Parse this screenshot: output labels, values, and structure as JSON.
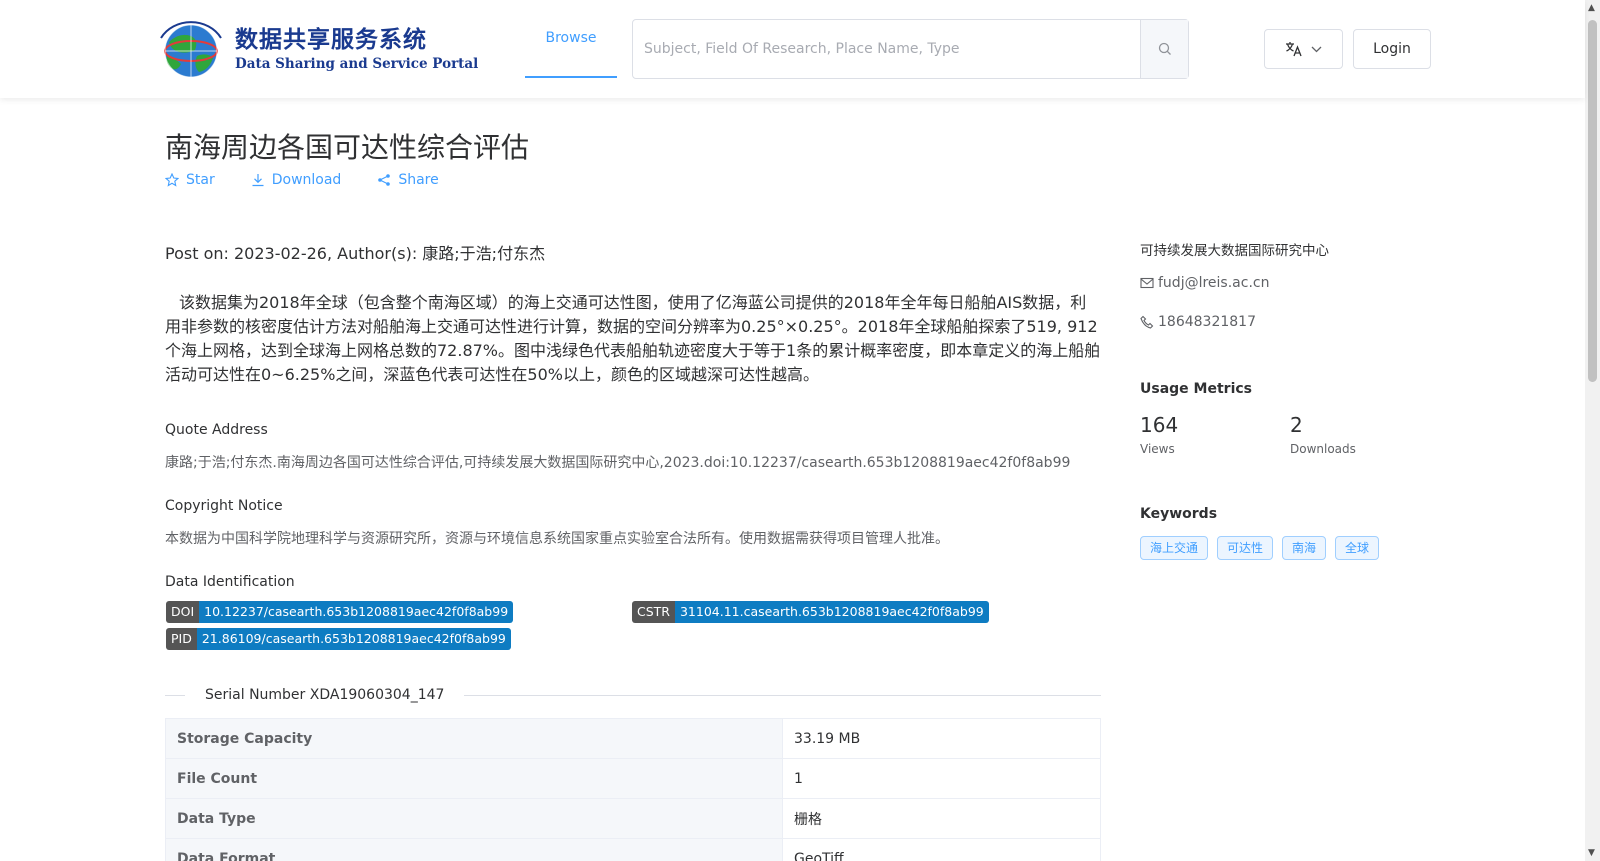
{
  "header": {
    "logo_cn": "数据共享服务系统",
    "logo_en": "Data Sharing and Service Portal",
    "nav_browse": "Browse",
    "search_placeholder": "Subject, Field Of Research, Place Name, Type",
    "login_label": "Login"
  },
  "dataset": {
    "title": "南海周边各国可达性综合评估",
    "actions": {
      "star": "Star",
      "download": "Download",
      "share": "Share"
    },
    "post_on": "Post on: 2023-02-26, Author(s): 康路;于浩;付东杰",
    "description": "该数据集为2018年全球（包含整个南海区域）的海上交通可达性图，使用了亿海蓝公司提供的2018年全年每日船舶AIS数据，利用非参数的核密度估计方法对船舶海上交通可达性进行计算，数据的空间分辨率为0.25°×0.25°。2018年全球船舶探索了519, 912个海上网格，达到全球海上网格总数的72.87%。图中浅绿色代表船舶轨迹密度大于等于1条的累计概率密度，即本章定义的海上船舶活动可达性在0~6.25%之间，深蓝色代表可达性在50%以上，颜色的区域越深可达性越高。",
    "quote_label": "Quote Address",
    "quote_text": "康路;于浩;付东杰.南海周边各国可达性综合评估,可持续发展大数据国际研究中心,2023.doi:10.12237/casearth.653b1208819aec42f0f8ab99",
    "copyright_label": "Copyright Notice",
    "copyright_text": "本数据为中国科学院地理科学与资源研究所，资源与环境信息系统国家重点实验室合法所有。使用数据需获得项目管理人批准。",
    "identification_label": "Data Identification",
    "identifiers": {
      "doi": {
        "key": "DOI",
        "value": "10.12237/casearth.653b1208819aec42f0f8ab99"
      },
      "cstr": {
        "key": "CSTR",
        "value": "31104.11.casearth.653b1208819aec42f0f8ab99"
      },
      "pid": {
        "key": "PID",
        "value": "21.86109/casearth.653b1208819aec42f0f8ab99"
      }
    },
    "serial": "Serial Number XDA19060304_147",
    "table": [
      {
        "key": "Storage Capacity",
        "value": "33.19 MB"
      },
      {
        "key": "File Count",
        "value": "1"
      },
      {
        "key": "Data Type",
        "value": "栅格"
      },
      {
        "key": "Data Format",
        "value": "GeoTiff"
      }
    ]
  },
  "sidebar": {
    "organization": "可持续发展大数据国际研究中心",
    "email": "fudj@lreis.ac.cn",
    "phone": "18648321817",
    "usage_title": "Usage Metrics",
    "views_value": "164",
    "views_label": "Views",
    "downloads_value": "2",
    "downloads_label": "Downloads",
    "keywords_title": "Keywords",
    "keywords": [
      "海上交通",
      "可达性",
      "南海",
      "全球"
    ]
  },
  "colors": {
    "accent": "#409eff",
    "badge_key": "#555555",
    "badge_value": "#0e7cc2",
    "logo_blue": "#1a3a8f"
  }
}
